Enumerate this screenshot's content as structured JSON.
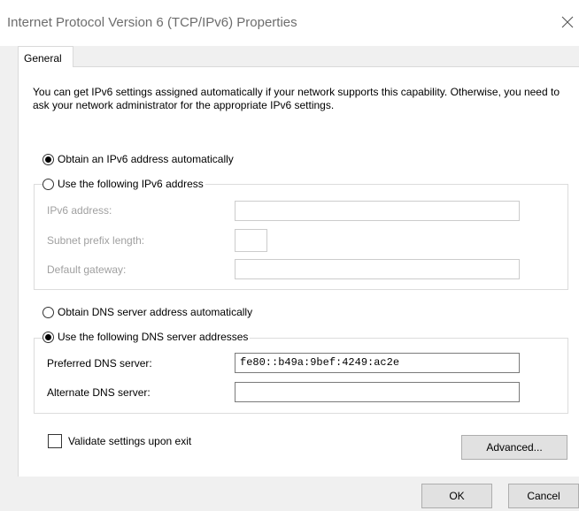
{
  "window": {
    "title": "Internet Protocol Version 6 (TCP/IPv6) Properties",
    "close_glyph": "✕"
  },
  "tabs": [
    {
      "label": "General",
      "selected": true
    }
  ],
  "description": "You can get IPv6 settings assigned automatically if your network supports this capability. Otherwise, you need to ask your network administrator for the appropriate IPv6 settings.",
  "ip_section": {
    "auto_option": {
      "label": "Obtain an IPv6 address automatically",
      "checked": true
    },
    "manual_option": {
      "label": "Use the following IPv6 address",
      "checked": false
    },
    "fields": {
      "address": {
        "label": "IPv6 address:",
        "value": ""
      },
      "prefix": {
        "label": "Subnet prefix length:",
        "value": ""
      },
      "gateway": {
        "label": "Default gateway:",
        "value": ""
      }
    }
  },
  "dns_section": {
    "auto_option": {
      "label": "Obtain DNS server address automatically",
      "checked": false
    },
    "manual_option": {
      "label": "Use the following DNS server addresses",
      "checked": true
    },
    "fields": {
      "preferred": {
        "label": "Preferred DNS server:",
        "value": "fe80::b49a:9bef:4249:ac2e"
      },
      "alternate": {
        "label": "Alternate DNS server:",
        "value": ""
      }
    }
  },
  "validate": {
    "label": "Validate settings upon exit",
    "checked": false
  },
  "buttons": {
    "advanced": "Advanced...",
    "ok": "OK",
    "cancel": "Cancel"
  }
}
